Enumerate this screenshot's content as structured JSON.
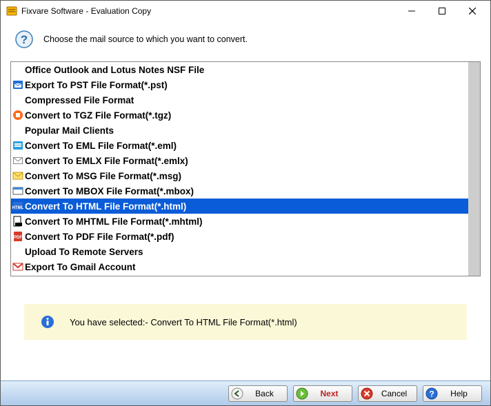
{
  "window": {
    "title": "Fixvare Software - Evaluation Copy"
  },
  "header": {
    "instruction": "Choose the mail source to which you want to convert."
  },
  "list": [
    {
      "kind": "header",
      "label": "Office Outlook and Lotus Notes NSF File"
    },
    {
      "kind": "item",
      "icon": "pst",
      "label": "Export To PST File Format(*.pst)"
    },
    {
      "kind": "header",
      "label": "Compressed File Format"
    },
    {
      "kind": "item",
      "icon": "tgz",
      "label": "Convert to TGZ File Format(*.tgz)"
    },
    {
      "kind": "header",
      "label": "Popular Mail Clients"
    },
    {
      "kind": "item",
      "icon": "eml",
      "label": "Convert To EML File Format(*.eml)"
    },
    {
      "kind": "item",
      "icon": "emlx",
      "label": "Convert To EMLX File Format(*.emlx)"
    },
    {
      "kind": "item",
      "icon": "msg",
      "label": "Convert To MSG File Format(*.msg)"
    },
    {
      "kind": "item",
      "icon": "mbox",
      "label": "Convert To MBOX File Format(*.mbox)"
    },
    {
      "kind": "item",
      "icon": "html",
      "label": "Convert To HTML File Format(*.html)",
      "selected": true
    },
    {
      "kind": "item",
      "icon": "mhtml",
      "label": "Convert To MHTML File Format(*.mhtml)"
    },
    {
      "kind": "item",
      "icon": "pdf",
      "label": "Convert To PDF File Format(*.pdf)"
    },
    {
      "kind": "header",
      "label": "Upload To Remote Servers"
    },
    {
      "kind": "item",
      "icon": "gmail",
      "label": "Export To Gmail Account"
    }
  ],
  "info": {
    "text": "You have selected:- Convert To HTML File Format(*.html)"
  },
  "buttons": {
    "back": "Back",
    "next": "Next",
    "cancel": "Cancel",
    "help": "Help"
  }
}
